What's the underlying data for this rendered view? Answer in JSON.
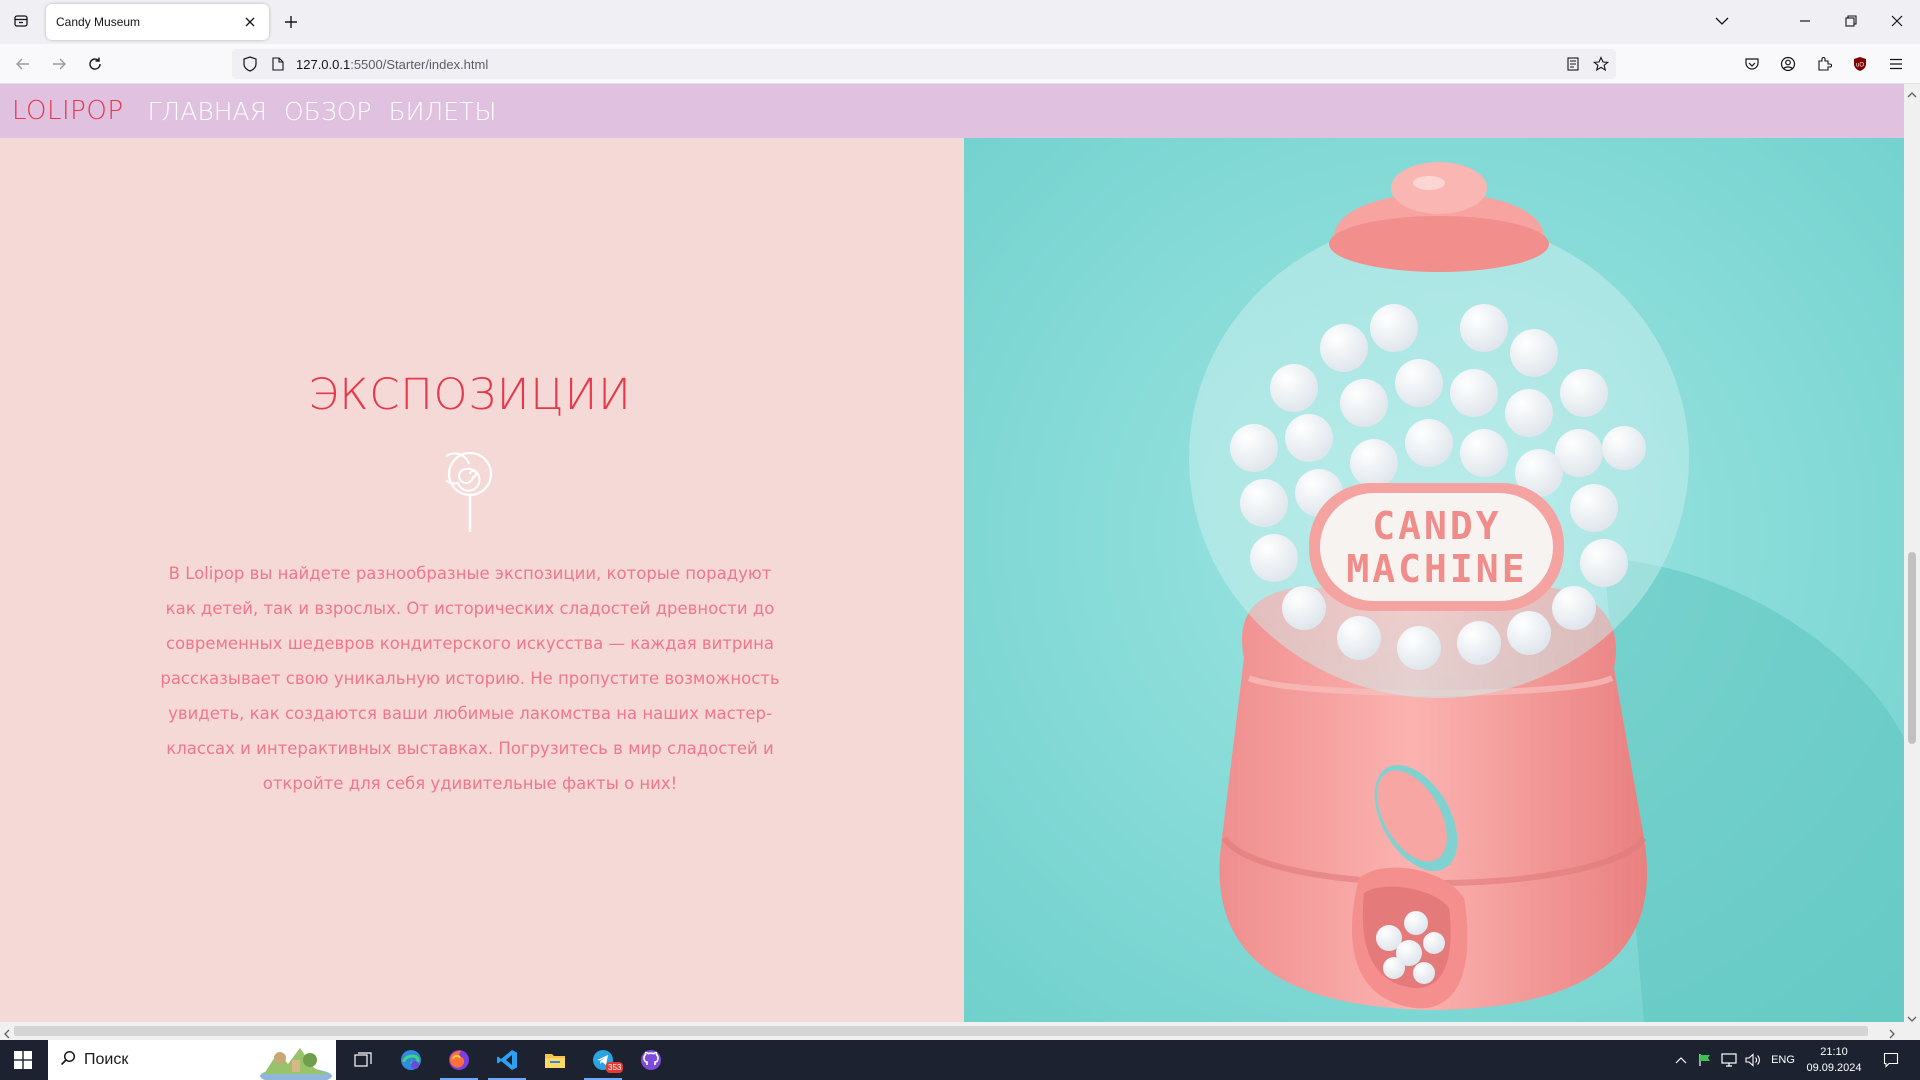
{
  "browser": {
    "tab_title": "Candy Museum",
    "url_host": "127.0.0.1",
    "url_path": ":5500/Starter/index.html"
  },
  "site": {
    "logo": "LOLIPOP",
    "menu": [
      "ГЛАВНАЯ",
      "ОБЗОР",
      "БИЛЕТЫ"
    ],
    "section_title": "ЭКСПОЗИЦИИ",
    "section_text": "В Lolipop вы найдете разнообразные экспозиции, которые порадуют как детей, так и взрослых. От исторических сладостей древности до современных шедевров кондитерского искусства — каждая витрина рассказывает свою уникальную историю. Не пропустите возможность увидеть, как создаются ваши любимые лакомства на наших мастер-классах и интерактивных выставках. Погрузитесь в мир сладостей и откройте для себя удивительные факты о них!",
    "image_label_line1": "CANDY",
    "image_label_line2": "MACHINE"
  },
  "colors": {
    "header_bg": "#e0c1e0",
    "left_bg": "#f5d9d7",
    "accent_red": "#e8374a",
    "text_pink": "#f0778a",
    "image_bg": "#88dcd9",
    "machine_pink": "#f7a3a3"
  },
  "taskbar": {
    "search_placeholder": "Поиск",
    "language": "ENG",
    "time": "21:10",
    "date": "09.09.2024",
    "telegram_badge": "353"
  }
}
